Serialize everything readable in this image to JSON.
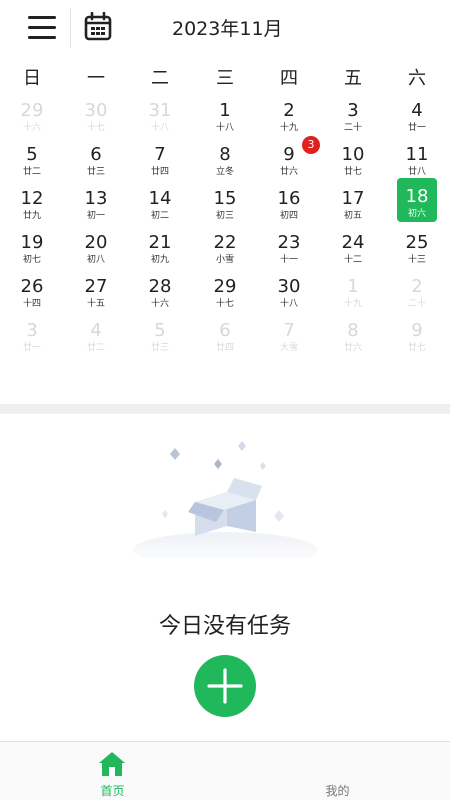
{
  "header": {
    "month_title": "2023年11月"
  },
  "weekdays": [
    "日",
    "一",
    "二",
    "三",
    "四",
    "五",
    "六"
  ],
  "calendar": {
    "days": [
      {
        "num": "29",
        "lunar": "十六",
        "faded": true
      },
      {
        "num": "30",
        "lunar": "十七",
        "faded": true
      },
      {
        "num": "31",
        "lunar": "十八",
        "faded": true
      },
      {
        "num": "1",
        "lunar": "十八"
      },
      {
        "num": "2",
        "lunar": "十九"
      },
      {
        "num": "3",
        "lunar": "二十"
      },
      {
        "num": "4",
        "lunar": "廿一"
      },
      {
        "num": "5",
        "lunar": "廿二"
      },
      {
        "num": "6",
        "lunar": "廿三"
      },
      {
        "num": "7",
        "lunar": "廿四"
      },
      {
        "num": "8",
        "lunar": "立冬"
      },
      {
        "num": "9",
        "lunar": "廿六"
      },
      {
        "num": "10",
        "lunar": "廿七"
      },
      {
        "num": "11",
        "lunar": "廿八"
      },
      {
        "num": "12",
        "lunar": "廿九"
      },
      {
        "num": "13",
        "lunar": "初一"
      },
      {
        "num": "14",
        "lunar": "初二"
      },
      {
        "num": "15",
        "lunar": "初三"
      },
      {
        "num": "16",
        "lunar": "初四"
      },
      {
        "num": "17",
        "lunar": "初五"
      },
      {
        "num": "18",
        "lunar": "初六",
        "selected": true
      },
      {
        "num": "19",
        "lunar": "初七"
      },
      {
        "num": "20",
        "lunar": "初八"
      },
      {
        "num": "21",
        "lunar": "初九"
      },
      {
        "num": "22",
        "lunar": "小雪"
      },
      {
        "num": "23",
        "lunar": "十一"
      },
      {
        "num": "24",
        "lunar": "十二"
      },
      {
        "num": "25",
        "lunar": "十三"
      },
      {
        "num": "26",
        "lunar": "十四"
      },
      {
        "num": "27",
        "lunar": "十五"
      },
      {
        "num": "28",
        "lunar": "十六"
      },
      {
        "num": "29",
        "lunar": "十七"
      },
      {
        "num": "30",
        "lunar": "十八"
      },
      {
        "num": "1",
        "lunar": "十九",
        "faded": true
      },
      {
        "num": "2",
        "lunar": "二十",
        "faded": true
      },
      {
        "num": "3",
        "lunar": "廿一",
        "faded": true
      },
      {
        "num": "4",
        "lunar": "廿二",
        "faded": true
      },
      {
        "num": "5",
        "lunar": "廿三",
        "faded": true
      },
      {
        "num": "6",
        "lunar": "廿四",
        "faded": true
      },
      {
        "num": "7",
        "lunar": "大雪",
        "faded": true
      },
      {
        "num": "8",
        "lunar": "廿六",
        "faded": true
      },
      {
        "num": "9",
        "lunar": "廿七",
        "faded": true
      }
    ],
    "badge": {
      "day": "9",
      "count": "3"
    }
  },
  "empty_state": {
    "message": "今日没有任务"
  },
  "tabbar": {
    "home_label": "首页",
    "mine_label": "我的"
  },
  "colors": {
    "accent": "#21b75b",
    "badge": "#e02020",
    "text": "#222222",
    "faded": "#d8d8d8"
  },
  "icons": {
    "menu": "menu-icon",
    "calendar": "calendar-icon",
    "add": "plus-icon",
    "home": "home-icon"
  }
}
